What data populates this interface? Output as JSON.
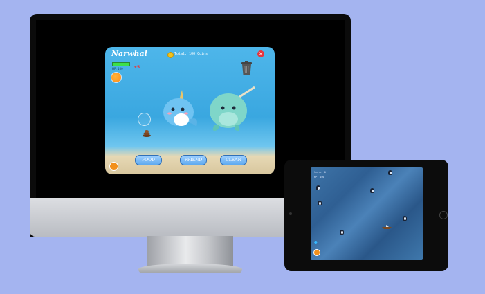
{
  "game": {
    "title": "Narwhal",
    "hp_label": "HP: 100",
    "hp_change": "+5",
    "total": "Total: 100 Coins",
    "close_icon": "×",
    "buttons": {
      "food": "FOOD",
      "friend": "FRIEND",
      "clean": "CLEAN"
    },
    "icons": [
      "coin-icon",
      "close-icon",
      "trash-can-icon",
      "orange-bubble-icon",
      "poop-icon",
      "bubble-icon",
      "narwhal-blue-icon",
      "narwhal-teal-icon",
      "paw-icon"
    ]
  },
  "ipad_game": {
    "score": "Score: 0",
    "hp": "HP: 100",
    "icons": [
      "penguin-icon",
      "pirate-ship-icon",
      "fish-icon",
      "paw-icon"
    ]
  },
  "device_icons": {
    "apple_logo": ""
  },
  "colors": {
    "background": "#a4b4f0",
    "ocean": "#3aa7e0",
    "button": "#5fa9ef",
    "close": "#e7343c",
    "hp": "#3ce04a"
  }
}
